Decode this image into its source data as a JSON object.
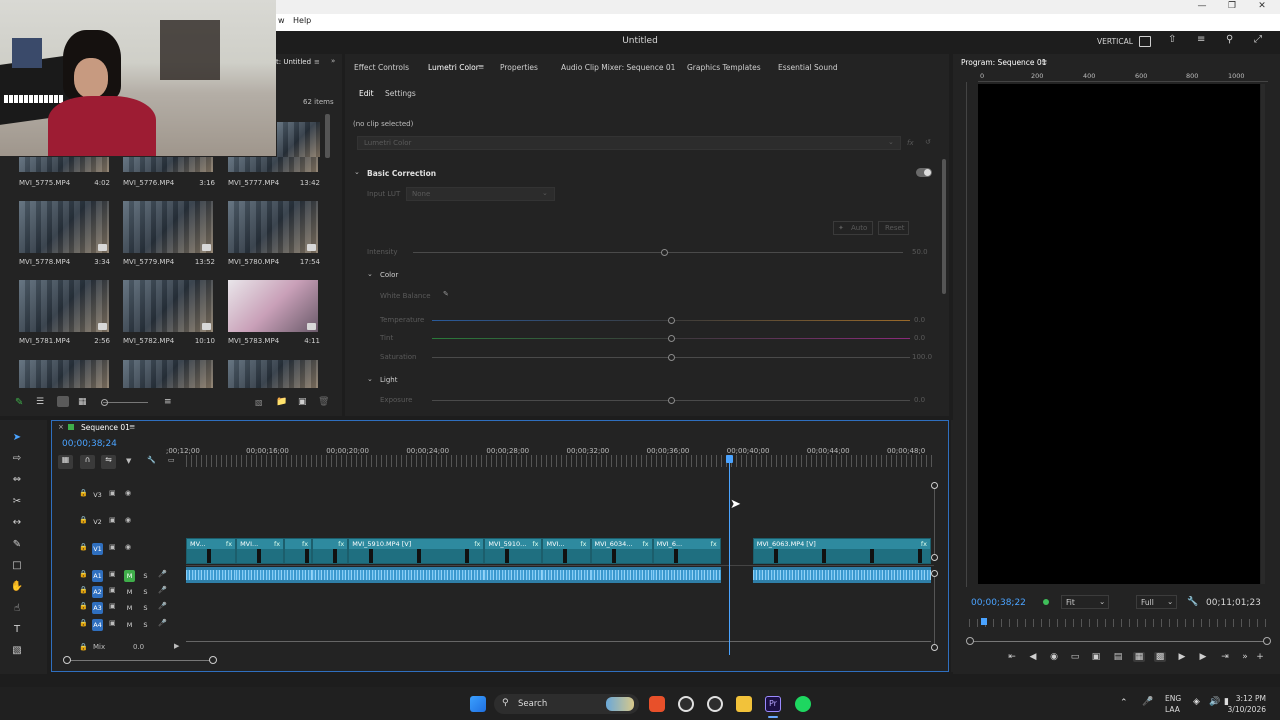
{
  "window": {
    "title": "Untitled",
    "menu": [
      "w",
      "Help"
    ],
    "workspace_label": "VERTICAL"
  },
  "project": {
    "tab": "t: Untitled",
    "item_count": "62 items",
    "clips": [
      {
        "name": "MVI_5775.MP4",
        "dur": "4:02"
      },
      {
        "name": "MVI_5776.MP4",
        "dur": "3:16"
      },
      {
        "name": "MVI_5777.MP4",
        "dur": "13:42"
      },
      {
        "name": "MVI_5778.MP4",
        "dur": "3:34"
      },
      {
        "name": "MVI_5779.MP4",
        "dur": "13:52"
      },
      {
        "name": "MVI_5780.MP4",
        "dur": "17:54"
      },
      {
        "name": "MVI_5781.MP4",
        "dur": "2:56"
      },
      {
        "name": "MVI_5782.MP4",
        "dur": "10:10"
      },
      {
        "name": "MVI_5783.MP4",
        "dur": "4:11"
      }
    ]
  },
  "lumetri": {
    "tabs": [
      "Effect Controls",
      "Lumetri Color",
      "Properties",
      "Audio Clip Mixer: Sequence 01",
      "Graphics Templates",
      "Essential Sound"
    ],
    "subtabs": [
      "Edit",
      "Settings"
    ],
    "no_clip": "(no clip selected)",
    "effect_select": "Lumetri Color",
    "basic_correction": "Basic Correction",
    "input_lut_label": "Input LUT",
    "input_lut_value": "None",
    "auto_label": "Auto",
    "reset_label": "Reset",
    "intensity_label": "Intensity",
    "intensity_value": "50.0",
    "color_section": "Color",
    "white_balance": "White Balance",
    "temperature_label": "Temperature",
    "temperature_value": "0.0",
    "tint_label": "Tint",
    "tint_value": "0.0",
    "saturation_label": "Saturation",
    "saturation_value": "100.0",
    "light_section": "Light",
    "exposure_label": "Exposure",
    "exposure_value": "0.0"
  },
  "program": {
    "tab": "Program: Sequence 01",
    "ruler": [
      "0",
      "200",
      "400",
      "600",
      "800",
      "1000"
    ],
    "timecode": "00;00;38;22",
    "fit": "Fit",
    "quality": "Full",
    "duration": "00;11;01;23"
  },
  "timeline": {
    "tab": "Sequence 01",
    "timecode": "00;00;38;24",
    "ruler": [
      {
        "label": ";00;12;00",
        "time_s": 12
      },
      {
        "label": "00;00;16;00",
        "time_s": 16
      },
      {
        "label": "00;00;20;00",
        "time_s": 20
      },
      {
        "label": "00;00;24;00",
        "time_s": 24
      },
      {
        "label": "00;00;28;00",
        "time_s": 28
      },
      {
        "label": "00;00;32;00",
        "time_s": 32
      },
      {
        "label": "00;00;36;00",
        "time_s": 36
      },
      {
        "label": "00;00;40;00",
        "time_s": 40
      },
      {
        "label": "00;00;44;00",
        "time_s": 44
      },
      {
        "label": "00;00;48;0",
        "time_s": 48
      }
    ],
    "video_tracks": [
      {
        "id": "V3",
        "label": "V3"
      },
      {
        "id": "V2",
        "label": "V2"
      },
      {
        "id": "V1",
        "label": "V1"
      }
    ],
    "audio_tracks": [
      {
        "id": "A1",
        "label": "A1"
      },
      {
        "id": "A2",
        "label": "A2"
      },
      {
        "id": "A3",
        "label": "A3"
      },
      {
        "id": "A4",
        "label": "A4"
      }
    ],
    "track_mute": "M",
    "track_solo": "S",
    "mix_label": "Mix",
    "mix_value": "0.0",
    "fx": "fx",
    "video_clips": [
      {
        "name": "MV...",
        "start_s": 11.8,
        "end_s": 14.3
      },
      {
        "name": "MVI...",
        "start_s": 14.3,
        "end_s": 16.7
      },
      {
        "name": "",
        "start_s": 16.7,
        "end_s": 18.1
      },
      {
        "name": "",
        "start_s": 18.1,
        "end_s": 19.9
      },
      {
        "name": "MVI_5910.MP4 [V]",
        "start_s": 19.9,
        "end_s": 26.7
      },
      {
        "name": "MVI_5910...",
        "start_s": 26.7,
        "end_s": 29.6
      },
      {
        "name": "MVI...",
        "start_s": 29.6,
        "end_s": 32.0
      },
      {
        "name": "MVI_6034...",
        "start_s": 32.0,
        "end_s": 35.1
      },
      {
        "name": "MVI_6...",
        "start_s": 35.1,
        "end_s": 38.5
      },
      {
        "name": "MVI_6063.MP4 [V]",
        "start_s": 40.1,
        "end_s": 49.0
      }
    ],
    "playhead_s": 38.9
  },
  "taskbar": {
    "search": "Search",
    "lang": "ENG",
    "lang2": "LAA",
    "time": "3:12 PM",
    "date": "3/10/2026"
  }
}
